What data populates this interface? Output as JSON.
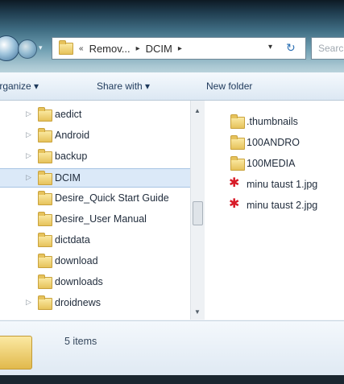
{
  "address_bar": {
    "overflow_glyph": "«",
    "segments": [
      "Remov...",
      "DCIM"
    ],
    "separator": "▸",
    "dropdown_glyph": "▾",
    "refresh_glyph": "↻"
  },
  "search": {
    "placeholder": "Search"
  },
  "toolbar": {
    "organize": "Organize ▾",
    "share_with": "Share with ▾",
    "new_folder": "New folder"
  },
  "nav_tree": [
    {
      "label": "aedict",
      "expander": "▷"
    },
    {
      "label": "Android",
      "expander": "▷"
    },
    {
      "label": "backup",
      "expander": "▷"
    },
    {
      "label": "DCIM",
      "expander": "▷",
      "selected": true
    },
    {
      "label": "Desire_Quick Start Guide",
      "expander": ""
    },
    {
      "label": "Desire_User Manual",
      "expander": ""
    },
    {
      "label": "dictdata",
      "expander": ""
    },
    {
      "label": "download",
      "expander": ""
    },
    {
      "label": "downloads",
      "expander": ""
    },
    {
      "label": "droidnews",
      "expander": "▷"
    }
  ],
  "content_items": [
    {
      "label": ".thumbnails",
      "type": "folder"
    },
    {
      "label": "100ANDRO",
      "type": "folder"
    },
    {
      "label": "100MEDIA",
      "type": "folder"
    },
    {
      "label": "minu taust 1.jpg",
      "type": "image"
    },
    {
      "label": "minu taust 2.jpg",
      "type": "image"
    }
  ],
  "status": {
    "count_text": "5 items"
  },
  "icons": {
    "folder": "folder-icon",
    "image": "jpg-file-icon",
    "back": "back-arrow-icon",
    "forward": "forward-arrow-icon",
    "file_glyph": "✱"
  }
}
